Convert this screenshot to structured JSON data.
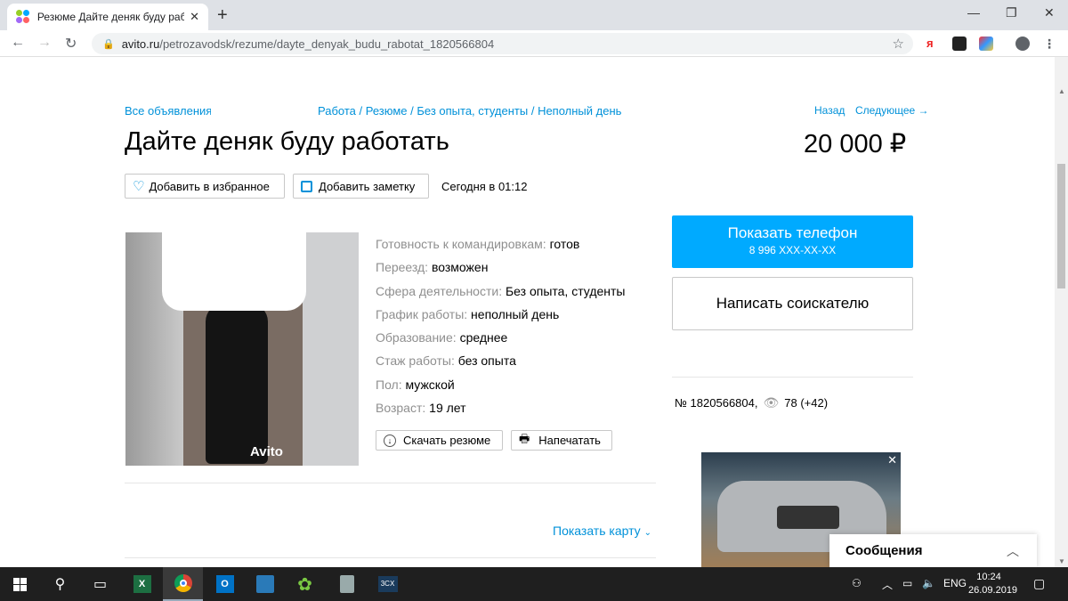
{
  "browser": {
    "tab_title": "Резюме Дайте деняк буду работ",
    "tab_close": "✕",
    "new_tab": "+",
    "url_host": "avito.ru",
    "url_path": "/petrozavodsk/rezume/dayte_denyak_budu_rabotat_1820566804",
    "window_minimize": "—",
    "window_restore": "❐",
    "window_close": "✕"
  },
  "breadcrumbs": {
    "all_ads": "Все объявления",
    "path": "Работа / Резюме / Без опыта, студенты / Неполный день",
    "back": "Назад",
    "next": "Следующее →"
  },
  "listing": {
    "title": "Дайте деняк буду работать",
    "price": "20 000 ₽",
    "add_favorite": "Добавить в избранное",
    "add_note": "Добавить заметку",
    "posted": "Сегодня в 01:12",
    "photo_watermark": "Avito"
  },
  "properties": [
    {
      "key": "Готовность к командировкам:",
      "value": "готов"
    },
    {
      "key": "Переезд:",
      "value": "возможен"
    },
    {
      "key": "Сфера деятельности:",
      "value": "Без опыта, студенты"
    },
    {
      "key": "График работы:",
      "value": "неполный день"
    },
    {
      "key": "Образование:",
      "value": "среднее"
    },
    {
      "key": "Стаж работы:",
      "value": "без опыта"
    },
    {
      "key": "Пол:",
      "value": "мужской"
    },
    {
      "key": "Возраст:",
      "value": "19 лет"
    }
  ],
  "actions": {
    "download": "Скачать резюме",
    "print": "Напечатать",
    "show_map": "Показать карту"
  },
  "contact": {
    "show_phone": "Показать телефон",
    "phone_masked": "8 996 XXX-XX-XX",
    "write": "Написать соискателю"
  },
  "stats": {
    "ad_number": "№ 1820566804,",
    "views": "78 (+42)"
  },
  "messages": {
    "label": "Сообщения"
  },
  "taskbar": {
    "lang": "ENG",
    "time": "10:24",
    "date": "26.09.2019"
  },
  "colors": {
    "link": "#0091d9",
    "primary_button": "#00aaff",
    "muted_text": "#8f8f8f"
  }
}
